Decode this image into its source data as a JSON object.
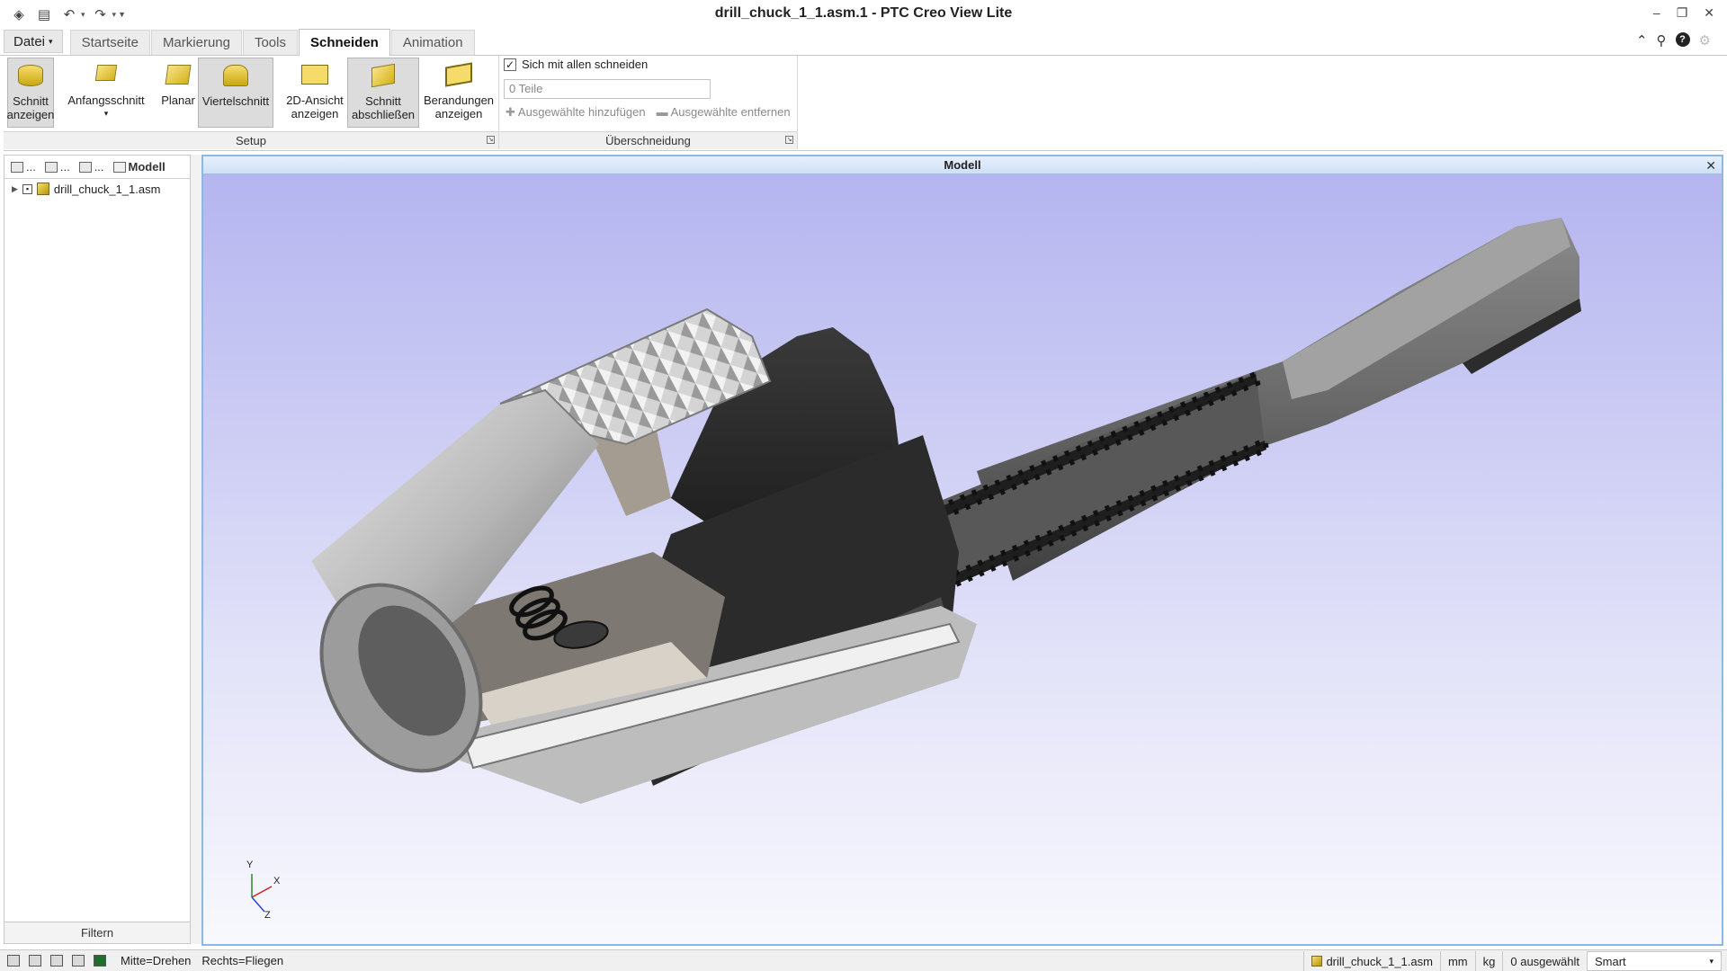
{
  "window": {
    "title": "drill_chuck_1_1.asm.1 - PTC Creo View Lite"
  },
  "menubar": {
    "file_label": "Datei",
    "tabs": [
      {
        "label": "Startseite",
        "active": false
      },
      {
        "label": "Markierung",
        "active": false
      },
      {
        "label": "Tools",
        "active": false
      },
      {
        "label": "Schneiden",
        "active": true
      },
      {
        "label": "Animation",
        "active": false
      }
    ]
  },
  "ribbon": {
    "setup_buttons": {
      "show_section": {
        "line1": "Schnitt",
        "line2": "anzeigen"
      },
      "initial_section": {
        "line1": "Anfangsschnitt",
        "line2": "▾"
      },
      "planar": {
        "line1": "Planar",
        "line2": ""
      },
      "quarter": {
        "line1": "Viertelschnitt",
        "line2": ""
      },
      "view_2d": {
        "line1": "2D-Ansicht",
        "line2": "anzeigen"
      },
      "close_section": {
        "line1": "Schnitt",
        "line2": "abschließen"
      },
      "show_edges": {
        "line1": "Berandungen",
        "line2": "anzeigen"
      }
    },
    "groups": {
      "setup": "Setup",
      "intersection": "Überschneidung"
    },
    "intersection": {
      "checkbox_label": "Sich mit allen schneiden",
      "checkbox_checked": true,
      "parts_placeholder": "0 Teile",
      "add_selected": "Ausgewählte hinzufügen",
      "remove_selected": "Ausgewählte entfernen"
    }
  },
  "tree_panel": {
    "tabs": [
      {
        "label": "...",
        "icon": "structure-icon"
      },
      {
        "label": "...",
        "icon": "markup-icon"
      },
      {
        "label": "...",
        "icon": "hierarchy-icon"
      },
      {
        "label": "Modell",
        "icon": "model-icon"
      }
    ],
    "root_item": "drill_chuck_1_1.asm",
    "filter_label": "Filtern"
  },
  "viewport": {
    "title": "Modell",
    "triad": {
      "x": "X",
      "y": "Y",
      "z": "Z"
    }
  },
  "statusbar": {
    "hint_rotate": "Mitte=Drehen",
    "hint_fly": "Rechts=Fliegen",
    "model_name": "drill_chuck_1_1.asm",
    "length_unit": "mm",
    "mass_unit": "kg",
    "selected": "0 ausgewählt",
    "selection_mode": "Smart"
  }
}
